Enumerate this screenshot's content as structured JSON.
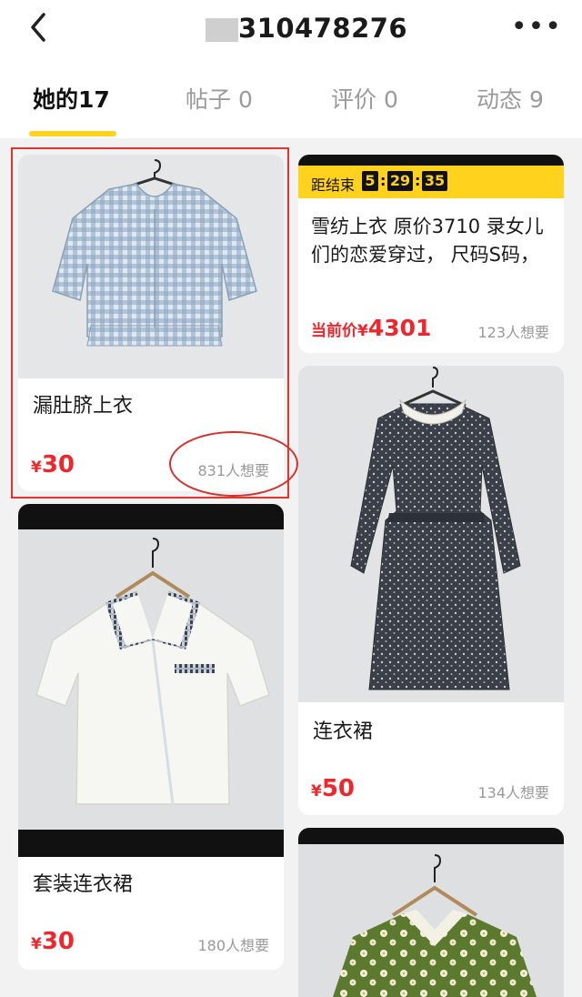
{
  "header": {
    "title": "310478276",
    "back_icon": "chevron-left-icon",
    "more_label": "•••"
  },
  "tabs": [
    {
      "label": "她的17",
      "active": true
    },
    {
      "label": "帖子 0",
      "active": false
    },
    {
      "label": "评价 0",
      "active": false
    },
    {
      "label": "动态 9",
      "active": false
    }
  ],
  "colors": {
    "accent": "#ffd21e",
    "price": "#f0262a",
    "highlight": "#e2352d"
  },
  "items": [
    {
      "name": "漏肚脐上衣",
      "currency": "¥",
      "price": "30",
      "want": "831人想要"
    },
    {
      "timer_label": "距结束",
      "timer_h": "5",
      "timer_m": "29",
      "timer_s": "35",
      "desc": "雪纺上衣  原价3710  录女儿们的恋爱穿过，  尺码S码，",
      "price_label": "当前价¥",
      "price": "4301",
      "want": "123人想要"
    },
    {
      "name": "连衣裙",
      "currency": "¥",
      "price": "50",
      "want": "134人想要"
    },
    {
      "name": "套装连衣裙",
      "currency": "¥",
      "price": "30",
      "want": "180人想要"
    }
  ]
}
